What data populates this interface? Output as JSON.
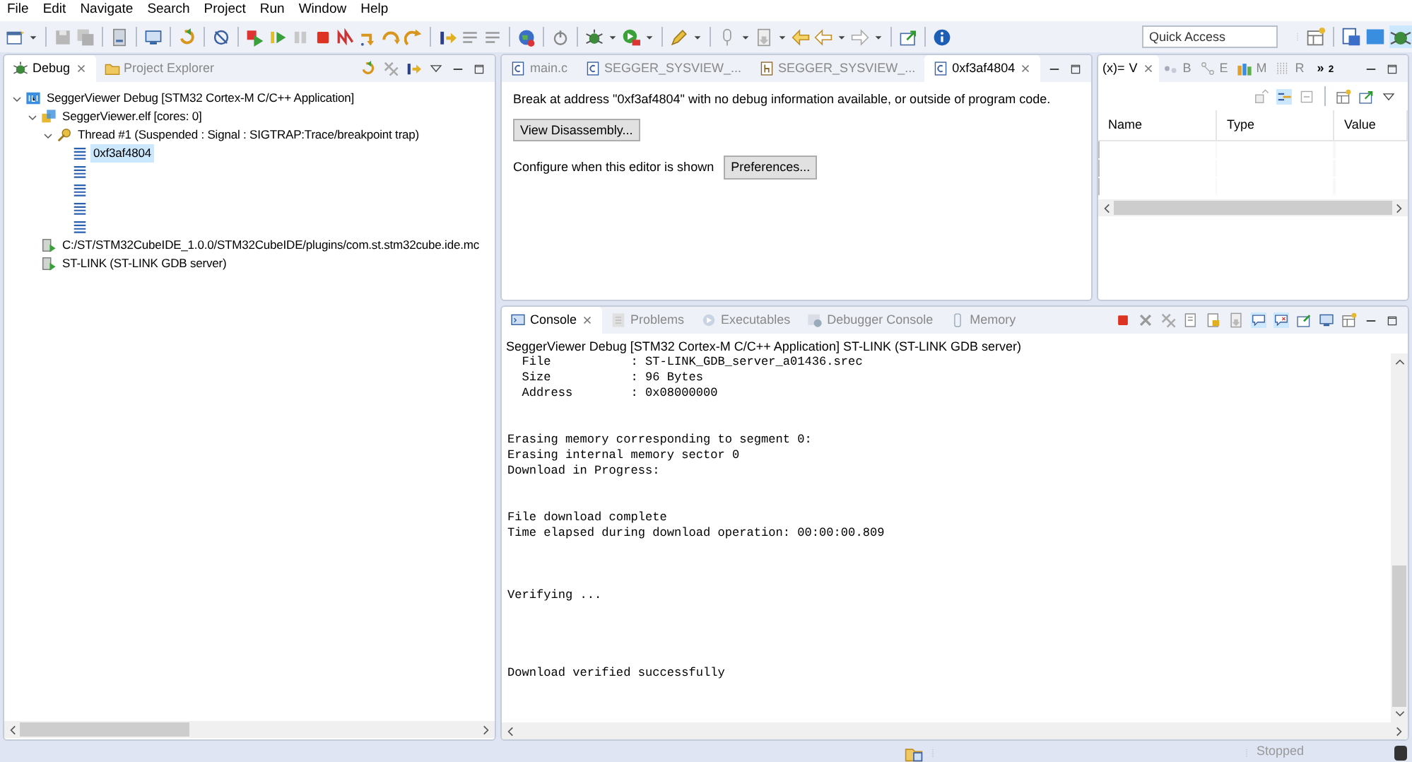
{
  "menu": [
    "File",
    "Edit",
    "Navigate",
    "Search",
    "Project",
    "Run",
    "Window",
    "Help"
  ],
  "toolbar": {
    "quick_access": {
      "placeholder": "Quick Access"
    }
  },
  "debug_view": {
    "tabs": [
      {
        "label": "Debug",
        "selected": true
      },
      {
        "label": "Project Explorer",
        "selected": false
      }
    ],
    "tree": [
      {
        "kind": "launch",
        "label": "SeggerViewer Debug [STM32 Cortex-M C/C++ Application]",
        "expanded": true,
        "selected": false,
        "children": [
          {
            "kind": "program",
            "label": "SeggerViewer.elf [cores: 0]",
            "expanded": true,
            "selected": false,
            "children": [
              {
                "kind": "thread",
                "label": "Thread #1 (Suspended : Signal : SIGTRAP:Trace/breakpoint trap)",
                "expanded": true,
                "selected": false,
                "children": [
                  {
                    "kind": "frame",
                    "label": "0xf3af4804",
                    "selected": true
                  },
                  {
                    "kind": "frame",
                    "selected": false
                  },
                  {
                    "kind": "frame",
                    "selected": false
                  },
                  {
                    "kind": "frame",
                    "selected": false
                  },
                  {
                    "kind": "frame",
                    "selected": false
                  }
                ]
              }
            ]
          },
          {
            "kind": "process",
            "label": "C:/ST/STM32CubeIDE_1.0.0/STM32CubeIDE/plugins/com.st.stm32cube.ide.mc",
            "selected": false
          },
          {
            "kind": "process",
            "label": "ST-LINK (ST-LINK GDB server)",
            "selected": false
          }
        ]
      }
    ]
  },
  "editor": {
    "tabs": [
      {
        "kind": "c",
        "label": "main.c",
        "selected": false
      },
      {
        "kind": "c",
        "label": "SEGGER_SYSVIEW_...",
        "selected": false
      },
      {
        "kind": "h",
        "label": "SEGGER_SYSVIEW_...",
        "selected": false
      },
      {
        "kind": "c",
        "label": "0xf3af4804",
        "selected": true
      }
    ],
    "message": "Break at address \"0xf3af4804\" with no debug information available, or outside of program code.",
    "disassembly_button": "View Disassembly...",
    "configure_label": "Configure when this editor is shown",
    "preferences_button": "Preferences..."
  },
  "variables_view": {
    "tabs": [
      {
        "prefix": "(x)=",
        "label": "V",
        "selected": true
      },
      {
        "label": "B",
        "selected": false
      },
      {
        "label": "E",
        "selected": false
      },
      {
        "label": "M",
        "selected": false
      },
      {
        "label": "R",
        "selected": false
      }
    ],
    "overflow": "»$_{2}$",
    "columns": [
      "Name",
      "Type",
      "Value"
    ]
  },
  "console_view": {
    "tabs": [
      {
        "label": "Console",
        "selected": true
      },
      {
        "label": "Problems",
        "selected": false
      },
      {
        "label": "Executables",
        "selected": false
      },
      {
        "label": "Debugger Console",
        "selected": false
      },
      {
        "label": "Memory",
        "selected": false
      }
    ],
    "header": "SeggerViewer Debug [STM32 Cortex-M C/C++ Application] ST-LINK (ST-LINK GDB server)",
    "lines": [
      {
        "kind": "text",
        "text": "  File           : ST-LINK_GDB_server_a01436.srec"
      },
      {
        "kind": "text",
        "text": "  Size           : 96 Bytes"
      },
      {
        "kind": "text",
        "text": "  Address        : 0x08000000"
      },
      {
        "kind": "blank"
      },
      {
        "kind": "blank"
      },
      {
        "kind": "text",
        "text": "Erasing memory corresponding to segment 0:"
      },
      {
        "kind": "text",
        "text": "Erasing internal memory sector 0"
      },
      {
        "kind": "text",
        "text": "Download in Progress:"
      },
      {
        "kind": "blank"
      },
      {
        "kind": "blank"
      },
      {
        "kind": "text",
        "text": "File download complete"
      },
      {
        "kind": "text",
        "text": "Time elapsed during download operation: 00:00:00.809"
      },
      {
        "kind": "blank"
      },
      {
        "kind": "blank"
      },
      {
        "kind": "blank"
      },
      {
        "kind": "text",
        "text": "Verifying ..."
      },
      {
        "kind": "blank"
      },
      {
        "kind": "blank"
      },
      {
        "kind": "blank"
      },
      {
        "kind": "blank"
      },
      {
        "kind": "text",
        "text": "Download verified successfully"
      }
    ]
  },
  "status_bar": {
    "state": "Stopped"
  }
}
